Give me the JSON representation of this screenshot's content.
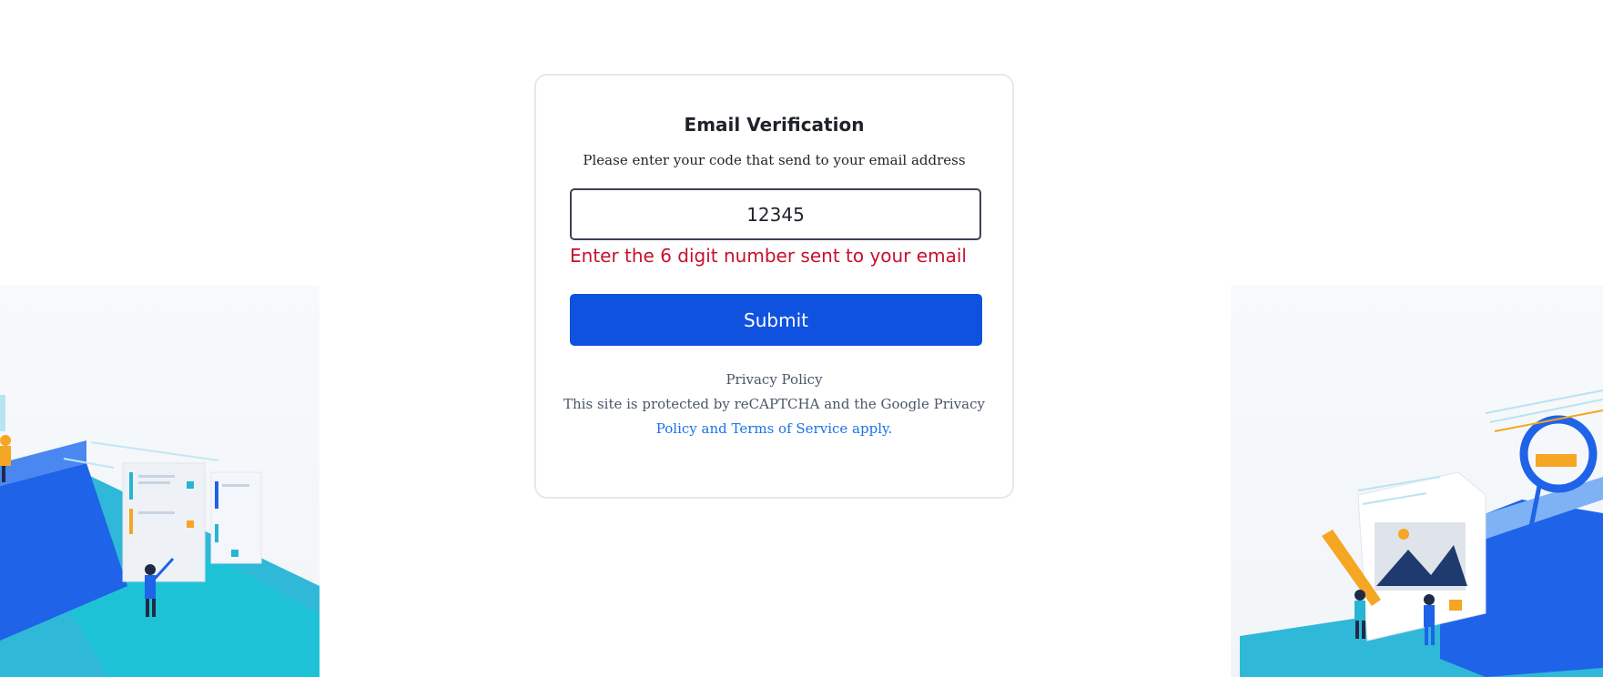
{
  "verification": {
    "title": "Email Verification",
    "subtitle": "Please enter your code that send to your email address",
    "code_value": "12345",
    "error_message": "Enter the 6 digit number sent to your email",
    "submit_label": "Submit"
  },
  "footer": {
    "privacy_policy": "Privacy Policy",
    "recaptcha_notice": "This site is protected by reCAPTCHA and the Google Privacy",
    "terms_link": "Policy and Terms of Service apply."
  },
  "colors": {
    "primary": "#0f52e0",
    "error": "#c8102e",
    "link": "#1a73e8"
  }
}
